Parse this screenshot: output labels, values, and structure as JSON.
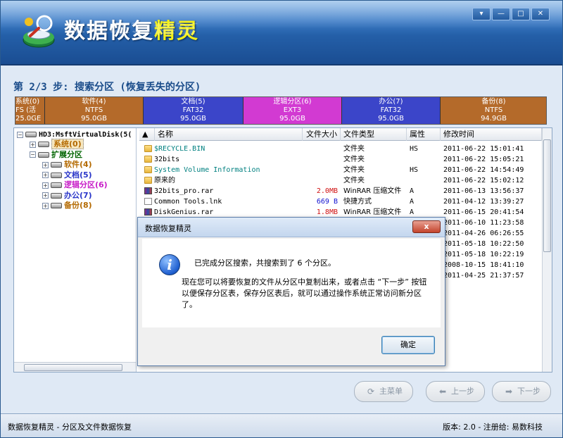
{
  "app": {
    "logo_title_white": "数据恢复",
    "logo_title_yellow": "精灵",
    "window_controls": [
      "▾",
      "—",
      "□",
      "✕"
    ]
  },
  "step_title": "第 2/3 步: 搜索分区 (恢复丢失的分区)",
  "disk_segments": [
    {
      "name": "系统(0)",
      "fs": "FS (活",
      "size": "25.0GE",
      "color": "#b46a2a"
    },
    {
      "name": "软件(4)",
      "fs": "NTFS",
      "size": "95.0GB",
      "color": "#b46a2a"
    },
    {
      "name": "文档(5)",
      "fs": "FAT32",
      "size": "95.0GB",
      "color": "#3b45c9"
    },
    {
      "name": "逻辑分区(6)",
      "fs": "EXT3",
      "size": "95.0GB",
      "color": "#d23ad2"
    },
    {
      "name": "办公(7)",
      "fs": "FAT32",
      "size": "95.0GB",
      "color": "#3b45c9"
    },
    {
      "name": "备份(8)",
      "fs": "NTFS",
      "size": "94.9GB",
      "color": "#b46a2a"
    }
  ],
  "tree": {
    "root": "HD3:MsftVirtualDisk(5(",
    "items": [
      {
        "label": "系统(0)",
        "color": "#b46a00",
        "highlight": true
      },
      {
        "label": "扩展分区",
        "color": "#006400"
      },
      {
        "label": "软件(4)",
        "color": "#b46a00"
      },
      {
        "label": "文档(5)",
        "color": "#2a36c9"
      },
      {
        "label": "逻辑分区(6)",
        "color": "#c81ec8"
      },
      {
        "label": "办公(7)",
        "color": "#2a36c9"
      },
      {
        "label": "备份(8)",
        "color": "#b46a00"
      }
    ]
  },
  "list": {
    "columns": {
      "name": "名称",
      "size": "文件大小",
      "type": "文件类型",
      "attr": "属性",
      "mtime": "修改时间"
    },
    "rows": [
      {
        "name": "$RECYCLE.BIN",
        "size": "",
        "type": "文件夹",
        "attr": "HS",
        "mtime": "2011-06-22 15:01:41",
        "icon": "folder",
        "name_color": "#008080"
      },
      {
        "name": "32bits",
        "size": "",
        "type": "文件夹",
        "attr": "",
        "mtime": "2011-06-22 15:05:21",
        "icon": "folder",
        "name_color": "#000000"
      },
      {
        "name": "System Volume Information",
        "size": "",
        "type": "文件夹",
        "attr": "HS",
        "mtime": "2011-06-22 14:54:49",
        "icon": "folder",
        "name_color": "#008080"
      },
      {
        "name": "原来的",
        "size": "",
        "type": "文件夹",
        "attr": "",
        "mtime": "2011-06-22 15:02:12",
        "icon": "folder",
        "name_color": "#000000"
      },
      {
        "name": "32bits_pro.rar",
        "size": "2.0MB",
        "type": "WinRAR 压缩文件",
        "attr": "A",
        "mtime": "2011-06-13 13:56:37",
        "icon": "rar",
        "name_color": "#000000",
        "size_color": "#d01010"
      },
      {
        "name": "Common Tools.lnk",
        "size": "669 B",
        "type": "快捷方式",
        "attr": "A",
        "mtime": "2011-04-12 13:39:27",
        "icon": "lnk",
        "name_color": "#000000",
        "size_color": "#1010d0"
      },
      {
        "name": "DiskGenius.rar",
        "size": "1.8MB",
        "type": "WinRAR 压缩文件",
        "attr": "A",
        "mtime": "2011-06-15 20:41:54",
        "icon": "rar",
        "name_color": "#000000",
        "size_color": "#d01010"
      },
      {
        "name": "",
        "size": "",
        "type": "",
        "attr": "",
        "mtime": "2011-06-10 11:23:58",
        "icon": "",
        "name_color": "#000000"
      },
      {
        "name": "",
        "size": "",
        "type": "",
        "attr": "",
        "mtime": "2011-04-26 06:26:55",
        "icon": "",
        "name_color": "#000000"
      },
      {
        "name": "",
        "size": "",
        "type": "",
        "attr": "",
        "mtime": "2011-05-18 10:22:50",
        "icon": "",
        "name_color": "#000000"
      },
      {
        "name": "",
        "size": "",
        "type": "",
        "attr": "",
        "mtime": "2011-05-18 10:22:19",
        "icon": "",
        "name_color": "#000000"
      },
      {
        "name": "",
        "size": "",
        "type": "",
        "attr": "",
        "mtime": "2008-10-15 18:41:10",
        "icon": "",
        "name_color": "#000000"
      },
      {
        "name": "",
        "size": "",
        "type": "",
        "attr": "",
        "mtime": "2011-04-25 21:37:57",
        "icon": "",
        "name_color": "#000000"
      }
    ]
  },
  "dialog": {
    "title": "数据恢复精灵",
    "close": "x",
    "message1": "已完成分区搜索，共搜索到了 6 个分区。",
    "message2": "现在您可以将要恢复的文件从分区中复制出来，或者点击 “下一步” 按钮以便保存分区表，保存分区表后，就可以通过操作系统正常访问新分区了。",
    "ok": "确定"
  },
  "nav": {
    "main_menu": "主菜单",
    "prev": "上一步",
    "next": "下一步"
  },
  "status": {
    "left": "数据恢复精灵 - 分区及文件数据恢复",
    "right": "版本: 2.0 - 注册给: 易数科技"
  }
}
